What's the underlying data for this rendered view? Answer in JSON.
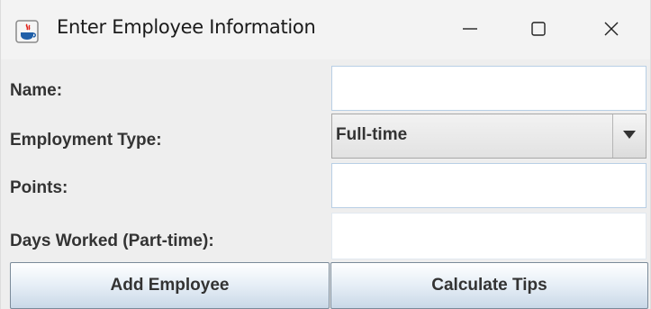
{
  "window": {
    "title": "Enter Employee Information",
    "icons": {
      "app": "java-app-icon",
      "minimize": "minimize-icon",
      "maximize": "maximize-icon",
      "close": "close-icon"
    }
  },
  "form": {
    "name_label": "Name:",
    "name_value": "",
    "employment_type_label": "Employment Type:",
    "employment_type_selected": "Full-time",
    "points_label": "Points:",
    "points_value": "",
    "days_worked_label": "Days Worked (Part-time):",
    "days_worked_value": ""
  },
  "buttons": {
    "add_employee": "Add Employee",
    "calculate_tips": "Calculate Tips"
  },
  "colors": {
    "field_border": "#b8cfe5",
    "button_gradient_bottom": "#c9d8e7",
    "window_bg": "#eeeeee"
  }
}
